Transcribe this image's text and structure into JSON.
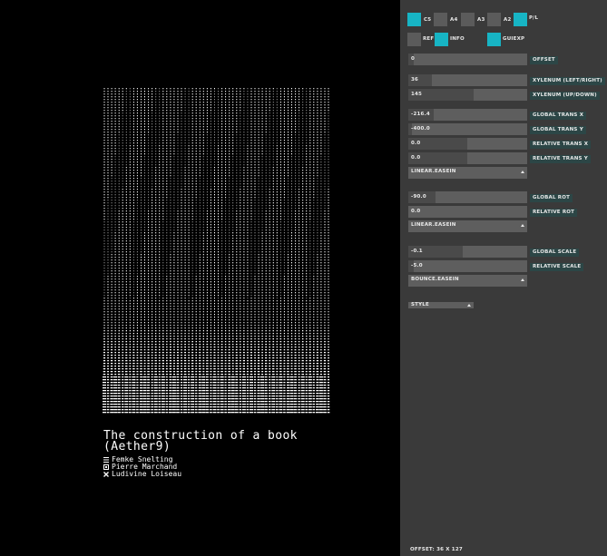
{
  "book": {
    "title_line1": "The construction of a book",
    "title_line2": "(Aether9)",
    "authors": [
      {
        "name": "Femke Snelting",
        "mark": "lines-icon"
      },
      {
        "name": "Pierre Marchand",
        "mark": "square-icon"
      },
      {
        "name": "Ludivine Loiseau",
        "mark": "cross-icon"
      }
    ]
  },
  "colors": {
    "accent": "#17b4c4",
    "panel": "#3a3a3a",
    "field": "#5e5e5e",
    "tag": "#2c4646"
  },
  "toggles": [
    {
      "label": "C5",
      "on": true
    },
    {
      "label": "A4",
      "on": false
    },
    {
      "label": "A3",
      "on": false
    },
    {
      "label": "A2",
      "on": false
    },
    {
      "label": "P/L",
      "on": true
    },
    {
      "label": "REF",
      "on": false
    },
    {
      "label": "INFO",
      "on": true
    },
    {
      "label": "GUIEXP",
      "on": true
    }
  ],
  "controls": {
    "offset": {
      "value": "0",
      "label": "OFFSET"
    },
    "columns": {
      "value": "36",
      "label": "XYLENUM   (LEFT/RIGHT)"
    },
    "rows": {
      "value": "145",
      "label": "XYLENUM   (UP/DOWN)"
    },
    "global_trans_x": {
      "value": "-216.4",
      "label": "GLOBAL TRANS X"
    },
    "global_trans_y": {
      "value": "-400.0",
      "label": "GLOBAL TRANS Y"
    },
    "relative_trans_x": {
      "value": "0.0",
      "label": "RELATIVE TRANS X"
    },
    "relative_trans_y": {
      "value": "0.0",
      "label": "RELATIVE TRANS Y"
    },
    "trans_easing": {
      "value": "LINEAR.EASEIN"
    },
    "global_rot": {
      "value": "-90.0",
      "label": "GLOBAL ROT"
    },
    "relative_rot": {
      "value": "0.0",
      "label": "RELATIVE ROT"
    },
    "rot_easing": {
      "value": "LINEAR.EASEIN"
    },
    "global_scale": {
      "value": "-0.1",
      "label": "GLOBAL SCALE"
    },
    "relative_scale": {
      "value": "-5.0",
      "label": "RELATIVE SCALE"
    },
    "scale_easing": {
      "value": "BOUNCE.EASEIN"
    },
    "style": {
      "value": "STYLE"
    }
  },
  "status": {
    "footer": "OFFSET: 36 X 127"
  }
}
